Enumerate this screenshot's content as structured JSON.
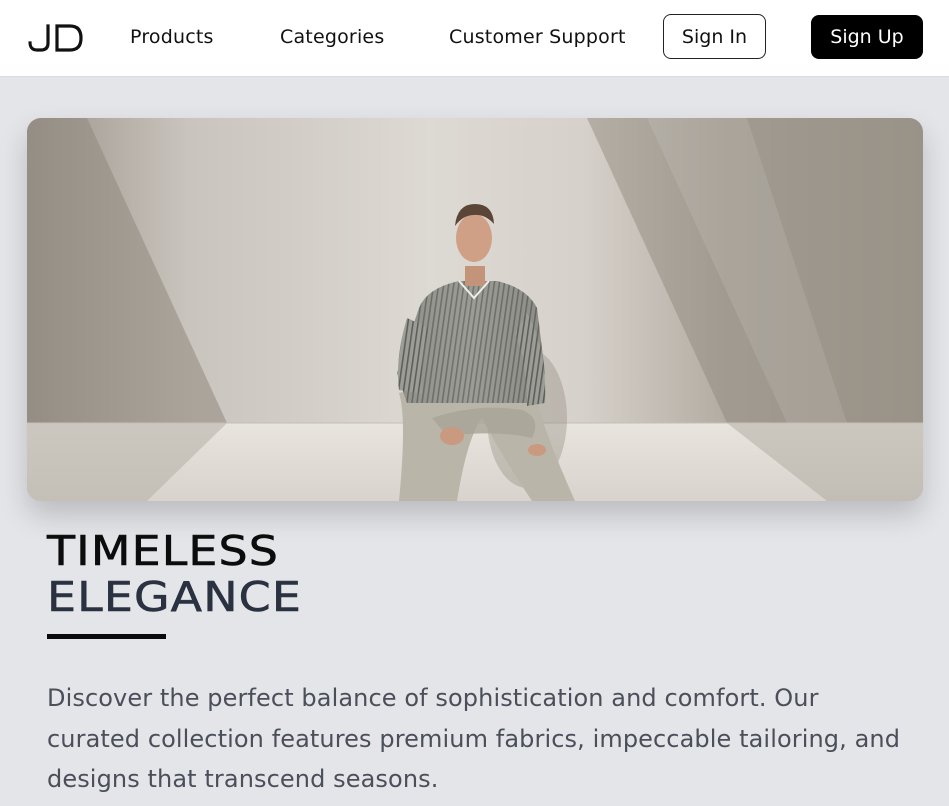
{
  "brand": {
    "logo_text": "JD"
  },
  "nav": {
    "products": "Products",
    "categories": "Categories",
    "support": "Customer Support"
  },
  "auth": {
    "sign_in": "Sign In",
    "sign_up": "Sign Up"
  },
  "hero": {
    "image": "man-in-striped-shirt-seated-against-wall-photo"
  },
  "headline": {
    "line1": "TIMELESS",
    "line2": "ELEGANCE"
  },
  "description": "Discover the perfect balance of sophistication and comfort. Our curated collection features premium fabrics, impeccable tailoring, and designs that transcend seasons.",
  "colors": {
    "background": "#e4e5e9",
    "navbar": "#ffffff",
    "primary_button": "#000000",
    "headline_secondary": "#2a3140",
    "body_text": "#4a4f5a"
  }
}
